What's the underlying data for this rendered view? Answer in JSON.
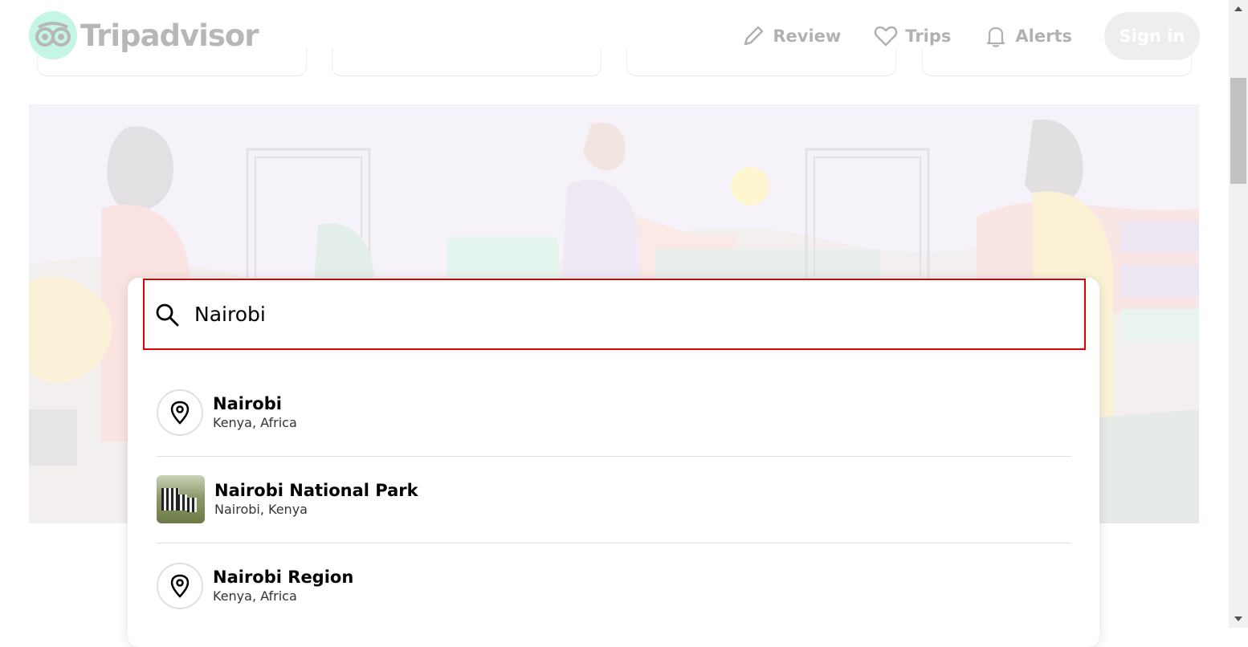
{
  "header": {
    "brand": "Tripadvisor",
    "nav": [
      {
        "label": "Review",
        "icon": "pencil-icon"
      },
      {
        "label": "Trips",
        "icon": "heart-icon"
      },
      {
        "label": "Alerts",
        "icon": "bell-icon"
      }
    ],
    "signin_label": "Sign in"
  },
  "search": {
    "value": "Nairobi",
    "focus_color": "#e10000"
  },
  "results": [
    {
      "title": "Nairobi",
      "subtitle": "Kenya, Africa",
      "icon": "location-pin-icon"
    },
    {
      "title": "Nairobi National Park",
      "subtitle": "Nairobi, Kenya",
      "icon": "zebra-thumbnail"
    },
    {
      "title": "Nairobi Region",
      "subtitle": "Kenya, Africa",
      "icon": "location-pin-icon"
    }
  ],
  "colors": {
    "brand_green": "#34e0a1",
    "signin_bg": "#c8c8c8"
  }
}
